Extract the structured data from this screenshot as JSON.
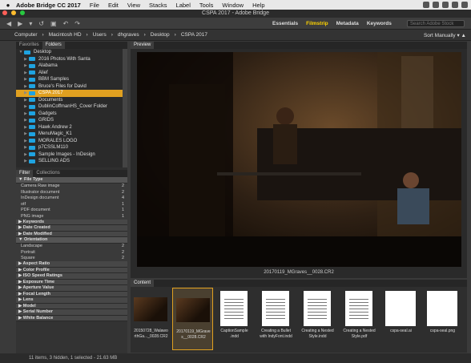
{
  "menubar": {
    "apple": "",
    "items": [
      "Adobe Bridge CC 2017",
      "File",
      "Edit",
      "View",
      "Stacks",
      "Label",
      "Tools",
      "Window",
      "Help"
    ]
  },
  "window": {
    "title": "CSPA 2017 - Adobe Bridge"
  },
  "toolbar": {
    "workspaces": [
      "Essentials",
      "Filmstrip",
      "Metadata",
      "Keywords"
    ],
    "active_workspace": "Filmstrip",
    "search_placeholder": "Search Adobe Stock"
  },
  "pathbar": {
    "crumbs": [
      "Computer",
      "Macintosh HD",
      "Users",
      "dhgraves",
      "Desktop",
      "CSPA 2017"
    ],
    "sort": "Sort Manually"
  },
  "left_tabs": [
    "Favorites",
    "Folders"
  ],
  "folders": [
    {
      "name": "Desktop",
      "level": 0,
      "open": true
    },
    {
      "name": "2016 Photos With Santa",
      "level": 1
    },
    {
      "name": "Alabama",
      "level": 1
    },
    {
      "name": "Alief",
      "level": 1
    },
    {
      "name": "BBM Samples",
      "level": 1
    },
    {
      "name": "Bruce's Files for David",
      "level": 1
    },
    {
      "name": "CSPA 2017",
      "level": 1,
      "selected": true
    },
    {
      "name": "Documents",
      "level": 1
    },
    {
      "name": "DublinCoffmanHS_Cover Folder",
      "level": 1
    },
    {
      "name": "Gadgets",
      "level": 1
    },
    {
      "name": "GRIDS",
      "level": 1
    },
    {
      "name": "Hawk Andrew 2",
      "level": 1
    },
    {
      "name": "MenuMagic_K1",
      "level": 1
    },
    {
      "name": "MORALES LOGO",
      "level": 1
    },
    {
      "name": "p7CSSLM110",
      "level": 1
    },
    {
      "name": "Sample Images - InDesign",
      "level": 1
    },
    {
      "name": "SELLING ADS",
      "level": 1
    }
  ],
  "filter_tabs": [
    "Filter",
    "Collections"
  ],
  "filters": {
    "file_type_header": "File Type",
    "file_types": [
      {
        "label": "Camera Raw image",
        "count": "2"
      },
      {
        "label": "Illustrator document",
        "count": "2"
      },
      {
        "label": "InDesign document",
        "count": "4"
      },
      {
        "label": "otf",
        "count": "1"
      },
      {
        "label": "PDF document",
        "count": "1"
      },
      {
        "label": "PNG image",
        "count": "1"
      }
    ],
    "keywords": "Keywords",
    "date_created": "Date Created",
    "date_modified": "Date Modified",
    "orientation_header": "Orientation",
    "orientations": [
      {
        "label": "Landscape",
        "count": "2"
      },
      {
        "label": "Portrait",
        "count": "2"
      },
      {
        "label": "Square",
        "count": "2"
      }
    ],
    "more": [
      "Aspect Ratio",
      "Color Profile",
      "ISO Speed Ratings",
      "Exposure Time",
      "Aperture Value",
      "Focal Length",
      "Lens",
      "Model",
      "Serial Number",
      "White Balance"
    ]
  },
  "preview": {
    "tab": "Preview",
    "caption": "20170119_MGraves__0028.CR2"
  },
  "content": {
    "tab": "Content",
    "items": [
      {
        "label": "20150728_Walawo\nrthGa..._0028.CR2",
        "kind": "photo"
      },
      {
        "label": "20170119_MGrave\ns__0028.CR2",
        "kind": "photo",
        "selected": true
      },
      {
        "label": "CaptionSample\n.indd",
        "kind": "doc"
      },
      {
        "label": "Creating a Bullet\nwith IndyFont.indd",
        "kind": "doc"
      },
      {
        "label": "Creating a Nested\nStyle.indd",
        "kind": "doc"
      },
      {
        "label": "Creating a Nested\nStyle.pdf",
        "kind": "doc"
      },
      {
        "label": "cspa-seal.ai",
        "kind": "seal"
      },
      {
        "label": "cspa-seal.png",
        "kind": "seal"
      }
    ]
  },
  "status": {
    "text": "11 items, 3 hidden, 1 selected - 21.63 MB"
  },
  "colors": {
    "accent": "#e0a020",
    "folder": "#1fa3e0",
    "highlight": "#ffd400"
  }
}
